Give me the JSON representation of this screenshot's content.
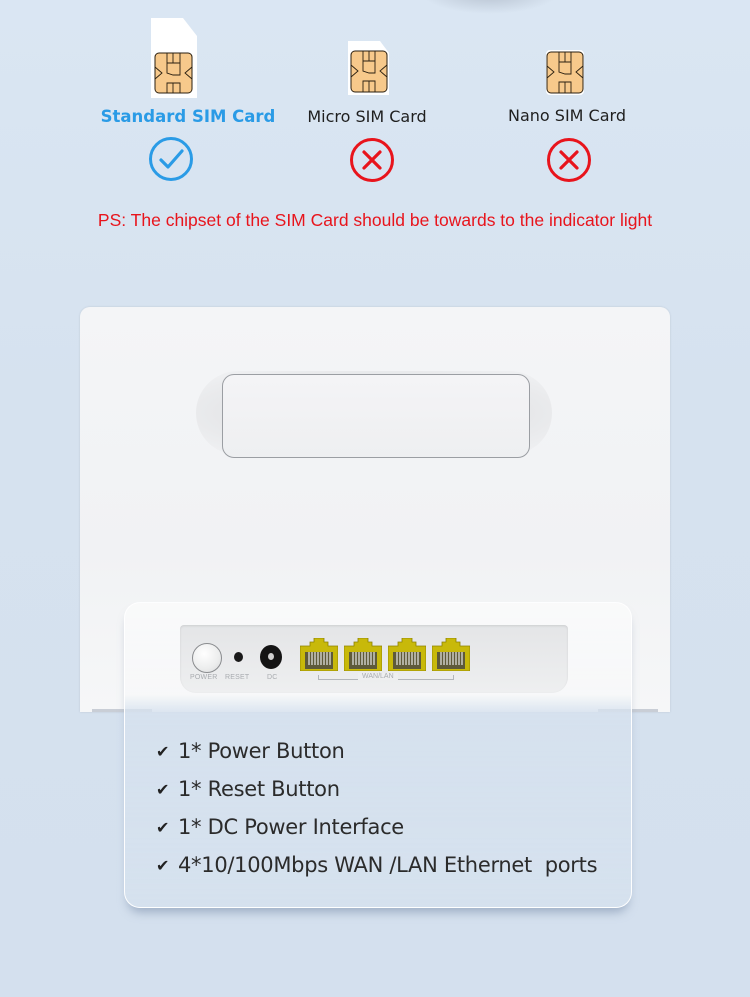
{
  "sim_types": [
    {
      "label": "Standard SIM Card",
      "status": "compatible",
      "status_icon": "check-circle-icon",
      "color": "#2a9be6"
    },
    {
      "label": "Micro SIM Card",
      "status": "not-compatible",
      "status_icon": "x-circle-icon",
      "color": "#e8141c"
    },
    {
      "label": "Nano SIM Card",
      "status": "not-compatible",
      "status_icon": "x-circle-icon",
      "color": "#e8141c"
    }
  ],
  "note": "PS: The chipset of the SIM Card should be towards to the indicator light",
  "router_ports": {
    "power_label": "POWER",
    "reset_label": "RESET",
    "dc_label": "DC",
    "wan_lan_label": "WAN/LAN",
    "ethernet_port_count": 4
  },
  "features": [
    {
      "check": "✔",
      "text": "1* Power Button"
    },
    {
      "check": "✔",
      "text": "1* Reset Button"
    },
    {
      "check": "✔",
      "text": "1* DC Power Interface"
    },
    {
      "check": "✔",
      "text": "4*10/100Mbps WAN /LAN Ethernet  ports"
    }
  ],
  "colors": {
    "accent_blue": "#2a9be6",
    "warning_red": "#e8141c",
    "background": "#d6e2ef",
    "chip_gold": "#f7c98b"
  }
}
